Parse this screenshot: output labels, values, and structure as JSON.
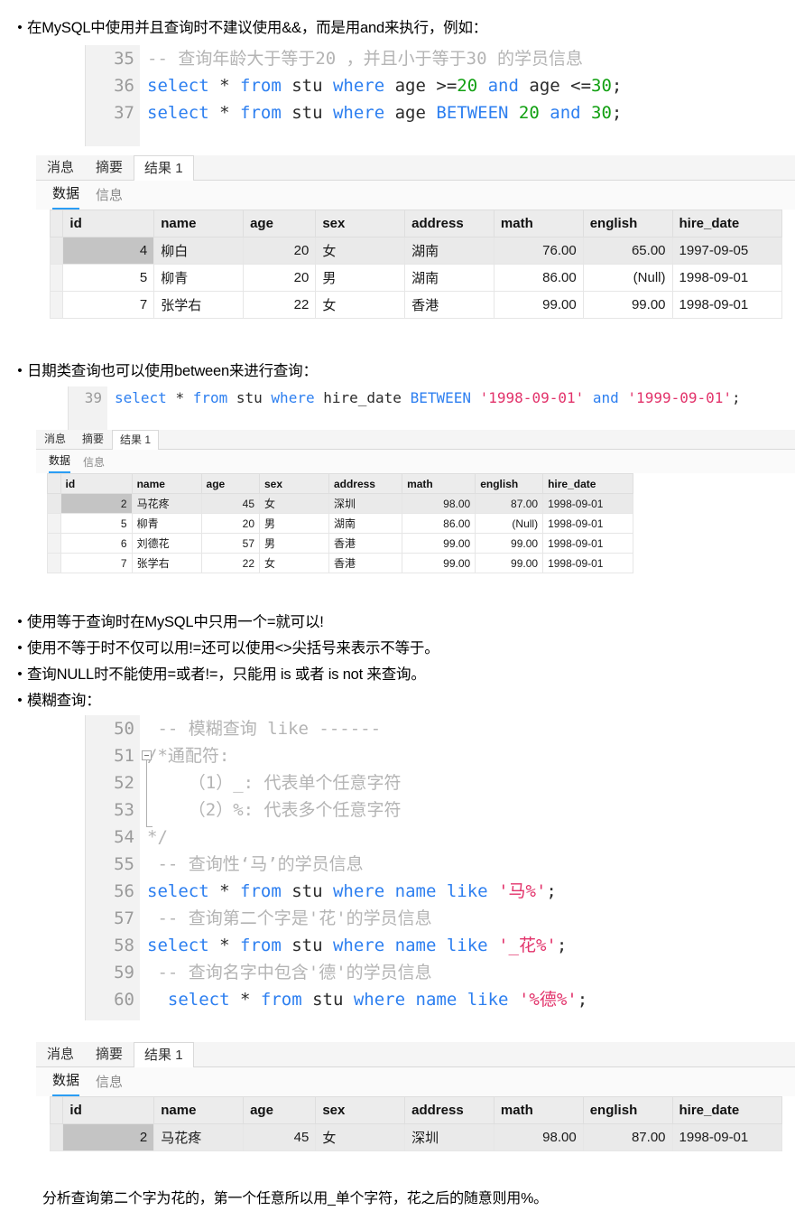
{
  "bullets": {
    "b1": "在MySQL中使用并且查询时不建议使用&&，而是用and来执行，例如：",
    "b2": "日期类查询也可以使用between来进行查询：",
    "b3": "使用等于查询时在MySQL中只用一个=就可以!",
    "b4": "使用不等于时不仅可以用!=还可以使用<>尖括号来表示不等于。",
    "b5": "查询NULL时不能使用=或者!=，只能用 is 或者 is not 来查询。",
    "b6": "模糊查询："
  },
  "code1": {
    "lines": [
      {
        "num": "35",
        "tokens": [
          {
            "t": "-- 查询年龄大于等于20 ，并且小于等于30 的学员信息",
            "c": "com"
          }
        ]
      },
      {
        "num": "36",
        "tokens": [
          {
            "t": "select",
            "c": "kw"
          },
          {
            "t": " ",
            "c": "plain"
          },
          {
            "t": "*",
            "c": "plain"
          },
          {
            "t": " ",
            "c": "plain"
          },
          {
            "t": "from",
            "c": "kw"
          },
          {
            "t": " stu ",
            "c": "plain"
          },
          {
            "t": "where",
            "c": "kw"
          },
          {
            "t": " age ",
            "c": "plain"
          },
          {
            "t": ">=",
            "c": "plain"
          },
          {
            "t": "20",
            "c": "num"
          },
          {
            "t": " ",
            "c": "plain"
          },
          {
            "t": "and",
            "c": "kw"
          },
          {
            "t": " age ",
            "c": "plain"
          },
          {
            "t": "<=",
            "c": "plain"
          },
          {
            "t": "30",
            "c": "num"
          },
          {
            "t": ";",
            "c": "plain"
          }
        ]
      },
      {
        "num": "37",
        "tokens": [
          {
            "t": "select",
            "c": "kw"
          },
          {
            "t": " ",
            "c": "plain"
          },
          {
            "t": "*",
            "c": "plain"
          },
          {
            "t": " ",
            "c": "plain"
          },
          {
            "t": "from",
            "c": "kw"
          },
          {
            "t": " stu ",
            "c": "plain"
          },
          {
            "t": "where",
            "c": "kw"
          },
          {
            "t": " age ",
            "c": "plain"
          },
          {
            "t": "BETWEEN",
            "c": "kw"
          },
          {
            "t": " ",
            "c": "plain"
          },
          {
            "t": "20",
            "c": "num"
          },
          {
            "t": " ",
            "c": "plain"
          },
          {
            "t": "and",
            "c": "kw"
          },
          {
            "t": " ",
            "c": "plain"
          },
          {
            "t": "30",
            "c": "num"
          },
          {
            "t": ";",
            "c": "plain"
          }
        ]
      }
    ]
  },
  "code2": {
    "lines": [
      {
        "num": "39",
        "tokens": [
          {
            "t": "select",
            "c": "kw"
          },
          {
            "t": " ",
            "c": "plain"
          },
          {
            "t": "*",
            "c": "plain"
          },
          {
            "t": " ",
            "c": "plain"
          },
          {
            "t": "from",
            "c": "kw"
          },
          {
            "t": " stu ",
            "c": "plain"
          },
          {
            "t": "where",
            "c": "kw"
          },
          {
            "t": " hire_date ",
            "c": "plain"
          },
          {
            "t": "BETWEEN",
            "c": "kw"
          },
          {
            "t": " ",
            "c": "plain"
          },
          {
            "t": "'1998-09-01'",
            "c": "str"
          },
          {
            "t": " ",
            "c": "plain"
          },
          {
            "t": "and",
            "c": "kw"
          },
          {
            "t": " ",
            "c": "plain"
          },
          {
            "t": "'1999-09-01'",
            "c": "str"
          },
          {
            "t": ";",
            "c": "plain"
          }
        ]
      }
    ]
  },
  "code3": {
    "lines": [
      {
        "num": "50",
        "tokens": [
          {
            "t": " -- 模糊查询 like ------",
            "c": "com"
          }
        ]
      },
      {
        "num": "51",
        "tokens": [
          {
            "t": "/*通配符:",
            "c": "com"
          }
        ]
      },
      {
        "num": "52",
        "tokens": [
          {
            "t": "    （1）_: 代表单个任意字符",
            "c": "com"
          }
        ]
      },
      {
        "num": "53",
        "tokens": [
          {
            "t": "    （2）%: 代表多个任意字符",
            "c": "com"
          }
        ]
      },
      {
        "num": "54",
        "tokens": [
          {
            "t": "*/",
            "c": "com"
          }
        ]
      },
      {
        "num": "55",
        "tokens": [
          {
            "t": " -- 查询性‘马’的学员信息",
            "c": "com"
          }
        ]
      },
      {
        "num": "56",
        "tokens": [
          {
            "t": "select",
            "c": "kw"
          },
          {
            "t": " ",
            "c": "plain"
          },
          {
            "t": "*",
            "c": "plain"
          },
          {
            "t": " ",
            "c": "plain"
          },
          {
            "t": "from",
            "c": "kw"
          },
          {
            "t": " stu ",
            "c": "plain"
          },
          {
            "t": "where",
            "c": "kw"
          },
          {
            "t": " ",
            "c": "plain"
          },
          {
            "t": "name",
            "c": "kw"
          },
          {
            "t": " ",
            "c": "plain"
          },
          {
            "t": "like",
            "c": "kw"
          },
          {
            "t": " ",
            "c": "plain"
          },
          {
            "t": "'马%'",
            "c": "str"
          },
          {
            "t": ";",
            "c": "plain"
          }
        ]
      },
      {
        "num": "57",
        "tokens": [
          {
            "t": " -- 查询第二个字是'花'的学员信息",
            "c": "com"
          }
        ]
      },
      {
        "num": "58",
        "tokens": [
          {
            "t": "select",
            "c": "kw"
          },
          {
            "t": " ",
            "c": "plain"
          },
          {
            "t": "*",
            "c": "plain"
          },
          {
            "t": " ",
            "c": "plain"
          },
          {
            "t": "from",
            "c": "kw"
          },
          {
            "t": " stu ",
            "c": "plain"
          },
          {
            "t": "where",
            "c": "kw"
          },
          {
            "t": " ",
            "c": "plain"
          },
          {
            "t": "name",
            "c": "kw"
          },
          {
            "t": " ",
            "c": "plain"
          },
          {
            "t": "like",
            "c": "kw"
          },
          {
            "t": " ",
            "c": "plain"
          },
          {
            "t": "'_花%'",
            "c": "str"
          },
          {
            "t": ";",
            "c": "plain"
          }
        ]
      },
      {
        "num": "59",
        "tokens": [
          {
            "t": " -- 查询名字中包含'德'的学员信息",
            "c": "com"
          }
        ]
      },
      {
        "num": "60",
        "tokens": [
          {
            "t": "  ",
            "c": "plain"
          },
          {
            "t": "select",
            "c": "kw"
          },
          {
            "t": " ",
            "c": "plain"
          },
          {
            "t": "*",
            "c": "plain"
          },
          {
            "t": " ",
            "c": "plain"
          },
          {
            "t": "from",
            "c": "kw"
          },
          {
            "t": " stu ",
            "c": "plain"
          },
          {
            "t": "where",
            "c": "kw"
          },
          {
            "t": " ",
            "c": "plain"
          },
          {
            "t": "name",
            "c": "kw"
          },
          {
            "t": " ",
            "c": "plain"
          },
          {
            "t": "like",
            "c": "kw"
          },
          {
            "t": " ",
            "c": "plain"
          },
          {
            "t": "'%德%'",
            "c": "str"
          },
          {
            "t": ";",
            "c": "plain"
          }
        ]
      }
    ]
  },
  "result_tabs": {
    "messages": "消息",
    "summary": "摘要",
    "result1": "结果 1",
    "data": "数据",
    "info": "信息"
  },
  "table_columns": [
    "id",
    "name",
    "age",
    "sex",
    "address",
    "math",
    "english",
    "hire_date"
  ],
  "result1": {
    "rows": [
      {
        "id": "4",
        "name": "柳白",
        "age": "20",
        "sex": "女",
        "address": "湖南",
        "math": "76.00",
        "english": "65.00",
        "hire_date": "1997-09-05",
        "selected": true
      },
      {
        "id": "5",
        "name": "柳青",
        "age": "20",
        "sex": "男",
        "address": "湖南",
        "math": "86.00",
        "english": "(Null)",
        "hire_date": "1998-09-01",
        "selected": false
      },
      {
        "id": "7",
        "name": "张学右",
        "age": "22",
        "sex": "女",
        "address": "香港",
        "math": "99.00",
        "english": "99.00",
        "hire_date": "1998-09-01",
        "selected": false
      }
    ]
  },
  "result2": {
    "rows": [
      {
        "id": "2",
        "name": "马花疼",
        "age": "45",
        "sex": "女",
        "address": "深圳",
        "math": "98.00",
        "english": "87.00",
        "hire_date": "1998-09-01",
        "selected": true
      },
      {
        "id": "5",
        "name": "柳青",
        "age": "20",
        "sex": "男",
        "address": "湖南",
        "math": "86.00",
        "english": "(Null)",
        "hire_date": "1998-09-01",
        "selected": false
      },
      {
        "id": "6",
        "name": "刘德花",
        "age": "57",
        "sex": "男",
        "address": "香港",
        "math": "99.00",
        "english": "99.00",
        "hire_date": "1998-09-01",
        "selected": false
      },
      {
        "id": "7",
        "name": "张学右",
        "age": "22",
        "sex": "女",
        "address": "香港",
        "math": "99.00",
        "english": "99.00",
        "hire_date": "1998-09-01",
        "selected": false
      }
    ]
  },
  "result3": {
    "rows": [
      {
        "id": "2",
        "name": "马花疼",
        "age": "45",
        "sex": "女",
        "address": "深圳",
        "math": "98.00",
        "english": "87.00",
        "hire_date": "1998-09-01",
        "selected": true
      }
    ]
  },
  "closing_note": "分析查询第二个字为花的，第一个任意所以用_单个字符，花之后的随意则用%。"
}
